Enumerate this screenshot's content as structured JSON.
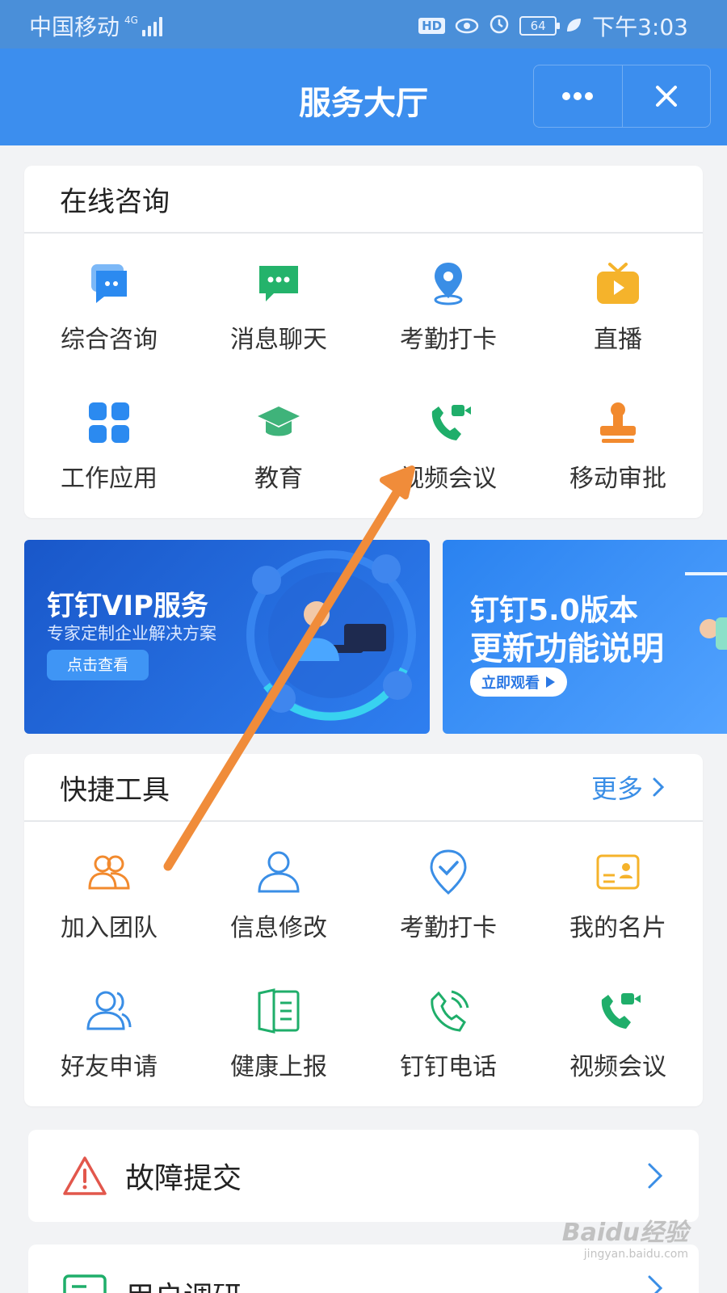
{
  "status_bar": {
    "carrier": "中国移动",
    "network": "4G",
    "hd": "HD",
    "battery": "64",
    "time": "下午3:03"
  },
  "title_bar": {
    "title": "服务大厅",
    "more_icon": "more-dots-icon",
    "close_icon": "close-icon"
  },
  "online_consult": {
    "title": "在线咨询",
    "items": [
      {
        "label": "综合咨询",
        "icon": "consult-chat-icon",
        "color": "#2b8af0"
      },
      {
        "label": "消息聊天",
        "icon": "message-icon",
        "color": "#24b36b"
      },
      {
        "label": "考勤打卡",
        "icon": "location-pin-icon",
        "color": "#3a8ee6"
      },
      {
        "label": "直播",
        "icon": "live-tv-icon",
        "color": "#f5b32b"
      },
      {
        "label": "工作应用",
        "icon": "apps-grid-icon",
        "color": "#2b8af0"
      },
      {
        "label": "教育",
        "icon": "graduation-cap-icon",
        "color": "#3fb37a"
      },
      {
        "label": "视频会议",
        "icon": "video-call-icon",
        "color": "#1fae6a"
      },
      {
        "label": "移动审批",
        "icon": "stamp-icon",
        "color": "#f28a2e"
      }
    ]
  },
  "banners": [
    {
      "title": "钉钉VIP服务",
      "subtitle": "专家定制企业解决方案",
      "button": "点击查看"
    },
    {
      "title_line1": "钉钉5.0版本",
      "title_line2": "更新功能说明",
      "button": "立即观看"
    }
  ],
  "quick_tools": {
    "title": "快捷工具",
    "more": "更多",
    "items": [
      {
        "label": "加入团队",
        "icon": "team-icon",
        "color": "#f28a2e"
      },
      {
        "label": "信息修改",
        "icon": "user-icon",
        "color": "#3a8ee6"
      },
      {
        "label": "考勤打卡",
        "icon": "location-check-icon",
        "color": "#3a8ee6"
      },
      {
        "label": "我的名片",
        "icon": "business-card-icon",
        "color": "#f5b32b"
      },
      {
        "label": "好友申请",
        "icon": "friends-icon",
        "color": "#3a8ee6"
      },
      {
        "label": "健康上报",
        "icon": "health-report-icon",
        "color": "#1fae6a"
      },
      {
        "label": "钉钉电话",
        "icon": "phone-icon",
        "color": "#1fae6a"
      },
      {
        "label": "视频会议",
        "icon": "video-call-icon",
        "color": "#1fae6a"
      }
    ]
  },
  "rows": [
    {
      "label": "故障提交",
      "icon": "warning-icon"
    },
    {
      "label": "用户调研",
      "icon": "survey-icon"
    }
  ],
  "watermark": {
    "brand": "Baidu经验",
    "url": "jingyan.baidu.com"
  }
}
